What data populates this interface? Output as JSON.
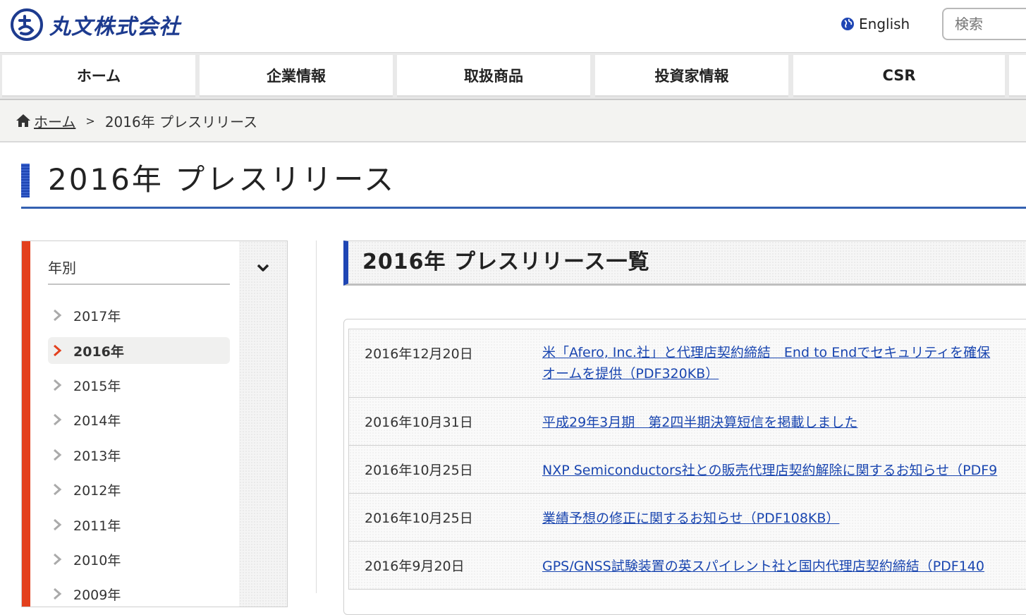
{
  "header": {
    "logo_text": "丸文株式会社",
    "lang_label": "English",
    "search_placeholder": "検索"
  },
  "nav": {
    "items": [
      "ホーム",
      "企業情報",
      "取扱商品",
      "投資家情報",
      "CSR"
    ]
  },
  "breadcrumb": {
    "home": "ホーム",
    "sep": ">",
    "current": "2016年 プレスリリース"
  },
  "page": {
    "title": "2016年 プレスリリース"
  },
  "sidebar": {
    "heading": "年別",
    "years": [
      "2017年",
      "2016年",
      "2015年",
      "2014年",
      "2013年",
      "2012年",
      "2011年",
      "2010年",
      "2009年"
    ],
    "active_year": "2016年"
  },
  "main": {
    "heading": "2016年 プレスリリース一覧",
    "releases": [
      {
        "date": "2016年12月20日",
        "title": "米「Afero, Inc.社」と代理店契約締結　End to Endでセキュリティを確保\nオームを提供（PDF320KB）"
      },
      {
        "date": "2016年10月31日",
        "title": "平成29年3月期　第2四半期決算短信を掲載しました"
      },
      {
        "date": "2016年10月25日",
        "title": "NXP Semiconductors社との販売代理店契約解除に関するお知らせ（PDF9"
      },
      {
        "date": "2016年10月25日",
        "title": "業績予想の修正に関するお知らせ（PDF108KB）"
      },
      {
        "date": "2016年9月20日",
        "title": "GPS/GNSS試験装置の英スパイレント社と国内代理店契約締結（PDF140"
      }
    ]
  },
  "colors": {
    "brand_blue": "#1d3b8f",
    "link_blue": "#1a46b0",
    "accent_red": "#e3401d"
  }
}
